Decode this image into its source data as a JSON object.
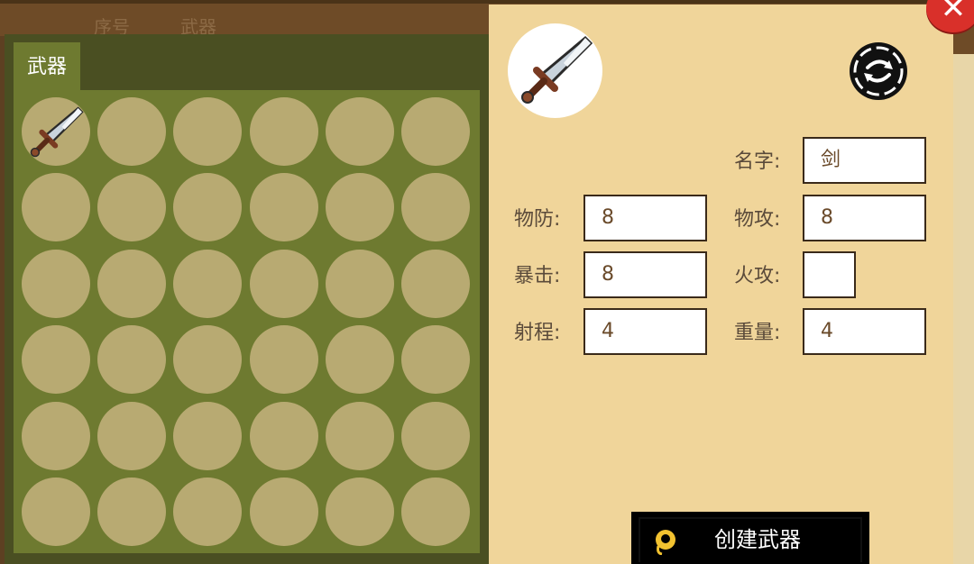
{
  "background_header": {
    "col1": "序号",
    "col2": "武器"
  },
  "inventory": {
    "tab_label": "武器",
    "slots": [
      {
        "item": "sword-icon"
      },
      {
        "item": ""
      },
      {
        "item": ""
      },
      {
        "item": ""
      },
      {
        "item": ""
      },
      {
        "item": ""
      },
      {
        "item": ""
      },
      {
        "item": ""
      },
      {
        "item": ""
      },
      {
        "item": ""
      },
      {
        "item": ""
      },
      {
        "item": ""
      },
      {
        "item": ""
      },
      {
        "item": ""
      },
      {
        "item": ""
      },
      {
        "item": ""
      },
      {
        "item": ""
      },
      {
        "item": ""
      },
      {
        "item": ""
      },
      {
        "item": ""
      },
      {
        "item": ""
      },
      {
        "item": ""
      },
      {
        "item": ""
      },
      {
        "item": ""
      },
      {
        "item": ""
      },
      {
        "item": ""
      },
      {
        "item": ""
      },
      {
        "item": ""
      },
      {
        "item": ""
      },
      {
        "item": ""
      },
      {
        "item": ""
      },
      {
        "item": ""
      },
      {
        "item": ""
      },
      {
        "item": ""
      },
      {
        "item": ""
      },
      {
        "item": ""
      }
    ]
  },
  "detail": {
    "portrait_icon": "sword-icon",
    "fields": {
      "name": {
        "label": "名字:",
        "value": "剑"
      },
      "phys_def": {
        "label": "物防:",
        "value": "8"
      },
      "phys_atk": {
        "label": "物攻:",
        "value": "8"
      },
      "crit": {
        "label": "暴击:",
        "value": "8"
      },
      "fire_atk": {
        "label": "火攻:",
        "value": ""
      },
      "range": {
        "label": "射程:",
        "value": "4"
      },
      "weight": {
        "label": "重量:",
        "value": "4"
      }
    },
    "create_button": {
      "label": "创建武器",
      "icon": "coin-icon"
    }
  },
  "close_button": {
    "glyph": "✕"
  },
  "colors": {
    "panel_green": "#6e7a30",
    "slot": "#b8aa72",
    "detail_bg": "#f0d59a",
    "close_red": "#d9302a"
  }
}
